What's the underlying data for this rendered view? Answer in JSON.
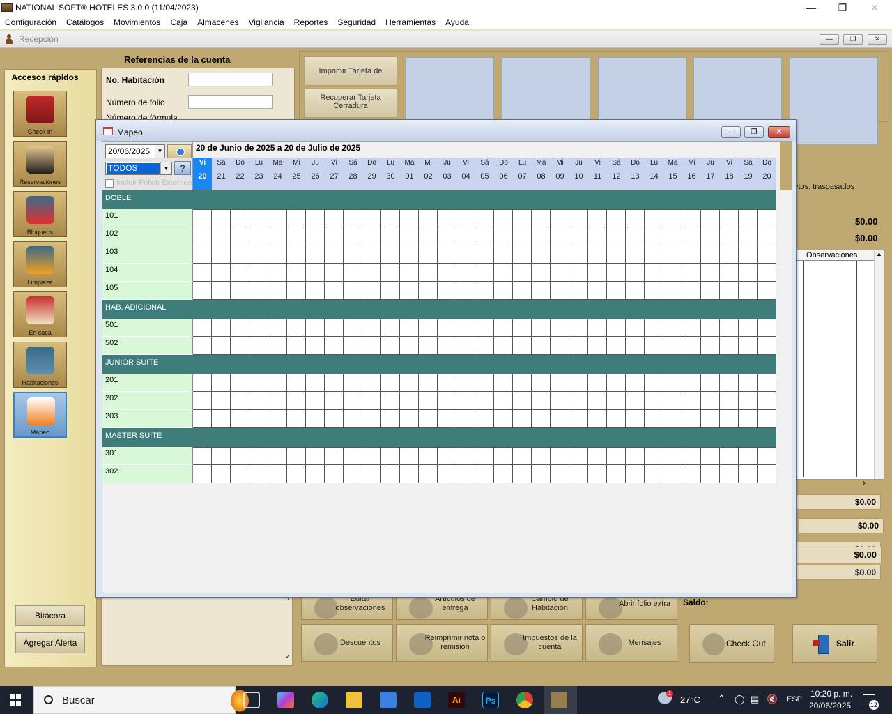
{
  "window": {
    "title": "NATIONAL SOFT® HOTELES 3.0.0 (11/04/2023)",
    "min": "—",
    "max": "❐",
    "close": "✕"
  },
  "menu": [
    "Configuración",
    "Catálogos",
    "Movimientos",
    "Caja",
    "Almacenes",
    "Vigilancia",
    "Reportes",
    "Seguridad",
    "Herramientas",
    "Ayuda"
  ],
  "child": {
    "title": "Recepción"
  },
  "accesos": {
    "title": "Accesos rápidos",
    "items": [
      "Check In",
      "Reservaciones",
      "Bloqueos",
      "Limpieza",
      "En casa",
      "Habitaciones",
      "Mapeo"
    ]
  },
  "refs": {
    "title": "Referencias de la cuenta",
    "habitacion_label": "No. Habitación",
    "folio_label": "Número de folio",
    "third_label": "Número de fórmula"
  },
  "top_buttons": {
    "imprimir": "Imprimir Tarjeta de Registro",
    "recuperar": "Recuperar Tarjeta Cerradura"
  },
  "right": {
    "traspasados": "vtos. traspasados",
    "amount1": "$0.00",
    "amount2": "$0.00",
    "obs_header": "Observaciones",
    "boxes": [
      "$0.00",
      "$0.00",
      "$0.00",
      "$0.00"
    ],
    "saldo_label": "Saldo:",
    "saldo": "$0.00"
  },
  "bottom_buttons": {
    "row1": [
      "Editar observaciones",
      "Artículos de entrega",
      "Cambio de Habitación",
      "Abrir folio extra"
    ],
    "row2": [
      "Descuentos",
      "Reimprimir nota o remisión",
      "Impuestos de la cuenta",
      "Mensajes"
    ],
    "checkout": "Check Out",
    "salir": "Salir"
  },
  "left_buttons": {
    "bitacora": "Bitácora",
    "agregar": "Agregar Alerta"
  },
  "mapeo": {
    "title": "Mapeo",
    "date": "20/06/2025",
    "type": "TODOS",
    "help": "?",
    "include_ext": "Incluir Folios Externos",
    "range": "20 de Junio de 2025 a 20 de Julio de 2025",
    "days": [
      {
        "n": "Vi",
        "d": "20"
      },
      {
        "n": "Sá",
        "d": "21"
      },
      {
        "n": "Do",
        "d": "22"
      },
      {
        "n": "Lu",
        "d": "23"
      },
      {
        "n": "Ma",
        "d": "24"
      },
      {
        "n": "Mi",
        "d": "25"
      },
      {
        "n": "Ju",
        "d": "26"
      },
      {
        "n": "Vi",
        "d": "27"
      },
      {
        "n": "Sá",
        "d": "28"
      },
      {
        "n": "Do",
        "d": "29"
      },
      {
        "n": "Lu",
        "d": "30"
      },
      {
        "n": "Ma",
        "d": "01"
      },
      {
        "n": "Mi",
        "d": "02"
      },
      {
        "n": "Ju",
        "d": "03"
      },
      {
        "n": "Vi",
        "d": "04"
      },
      {
        "n": "Sá",
        "d": "05"
      },
      {
        "n": "Do",
        "d": "06"
      },
      {
        "n": "Lu",
        "d": "07"
      },
      {
        "n": "Ma",
        "d": "08"
      },
      {
        "n": "Mi",
        "d": "09"
      },
      {
        "n": "Ju",
        "d": "10"
      },
      {
        "n": "Vi",
        "d": "11"
      },
      {
        "n": "Sá",
        "d": "12"
      },
      {
        "n": "Do",
        "d": "13"
      },
      {
        "n": "Lu",
        "d": "14"
      },
      {
        "n": "Ma",
        "d": "15"
      },
      {
        "n": "Mi",
        "d": "16"
      },
      {
        "n": "Ju",
        "d": "17"
      },
      {
        "n": "Vi",
        "d": "18"
      },
      {
        "n": "Sá",
        "d": "19"
      },
      {
        "n": "Do",
        "d": "20"
      }
    ],
    "groups": [
      {
        "name": "DOBLE",
        "rooms": [
          "101",
          "102",
          "103",
          "104",
          "105"
        ]
      },
      {
        "name": "HAB. ADICIONAL",
        "rooms": [
          "501",
          "502"
        ]
      },
      {
        "name": "JUNIOR SUITE",
        "rooms": [
          "201",
          "202",
          "203"
        ]
      },
      {
        "name": "MASTER SUITE",
        "rooms": [
          "301",
          "302"
        ]
      }
    ]
  },
  "taskbar": {
    "search": "Buscar",
    "temp": "27°C",
    "lang": "ESP",
    "time": "10:20 p. m.",
    "date": "20/06/2025",
    "notif": "12",
    "weather_badge": "1"
  }
}
